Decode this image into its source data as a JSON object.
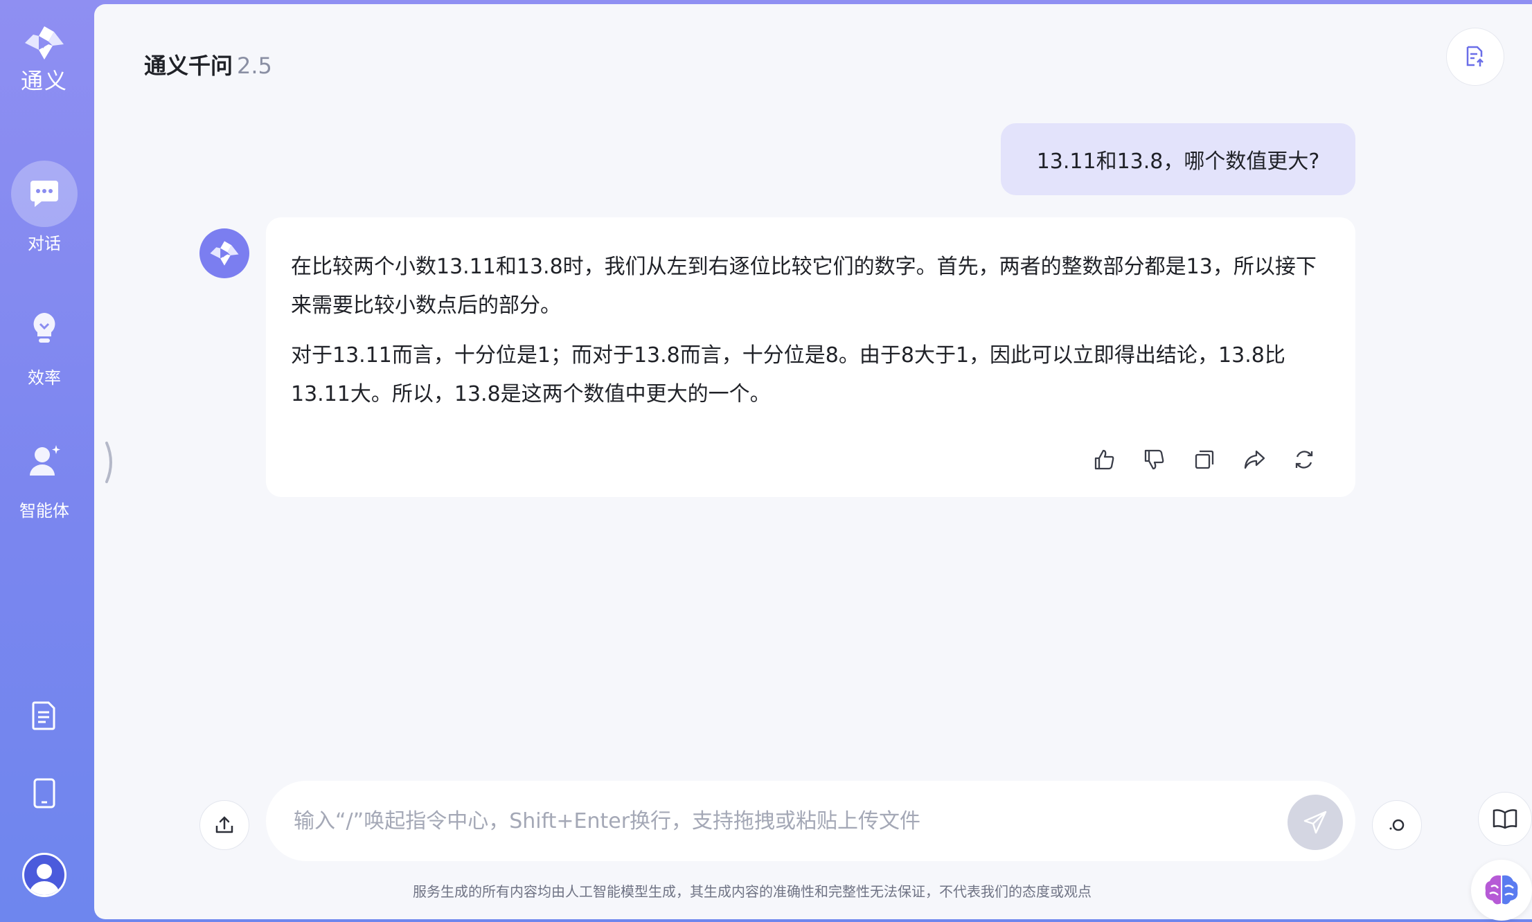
{
  "app": {
    "logo_text": "通义",
    "title": "通义千问",
    "version": "2.5"
  },
  "sidebar": {
    "items": [
      {
        "label": "对话",
        "icon": "chat-icon",
        "active": true
      },
      {
        "label": "效率",
        "icon": "lightbulb-icon",
        "active": false
      },
      {
        "label": "智能体",
        "icon": "agent-icon",
        "active": false
      }
    ],
    "bottom_icons": [
      "document-icon",
      "tablet-icon"
    ],
    "avatar_icon": "user-avatar-icon"
  },
  "conversation": {
    "user_message": "13.11和13.8，哪个数值更大?",
    "bot_paragraphs": [
      "在比较两个小数13.11和13.8时，我们从左到右逐位比较它们的数字。首先，两者的整数部分都是13，所以接下来需要比较小数点后的部分。",
      "对于13.11而言，十分位是1；而对于13.8而言，十分位是8。由于8大于1，因此可以立即得出结论，13.8比13.11大。所以，13.8是这两个数值中更大的一个。"
    ],
    "actions": [
      "thumbs-up-icon",
      "thumbs-down-icon",
      "copy-icon",
      "share-icon",
      "regenerate-icon"
    ]
  },
  "composer": {
    "placeholder": "输入“/”唤起指令中心，Shift+Enter换行，支持拖拽或粘贴上传文件",
    "value": ""
  },
  "footer": {
    "disclaimer": "服务生成的所有内容均由人工智能模型生成，其生成内容的准确性和完整性无法保证，不代表我们的态度或观点"
  },
  "colors": {
    "sidebar_gradient_top": "#8f8ff2",
    "sidebar_gradient_bottom": "#6e86ee",
    "accent": "#7b7ef0",
    "user_bubble": "#e3e3fb",
    "panel_bg": "#f6f7fb"
  }
}
